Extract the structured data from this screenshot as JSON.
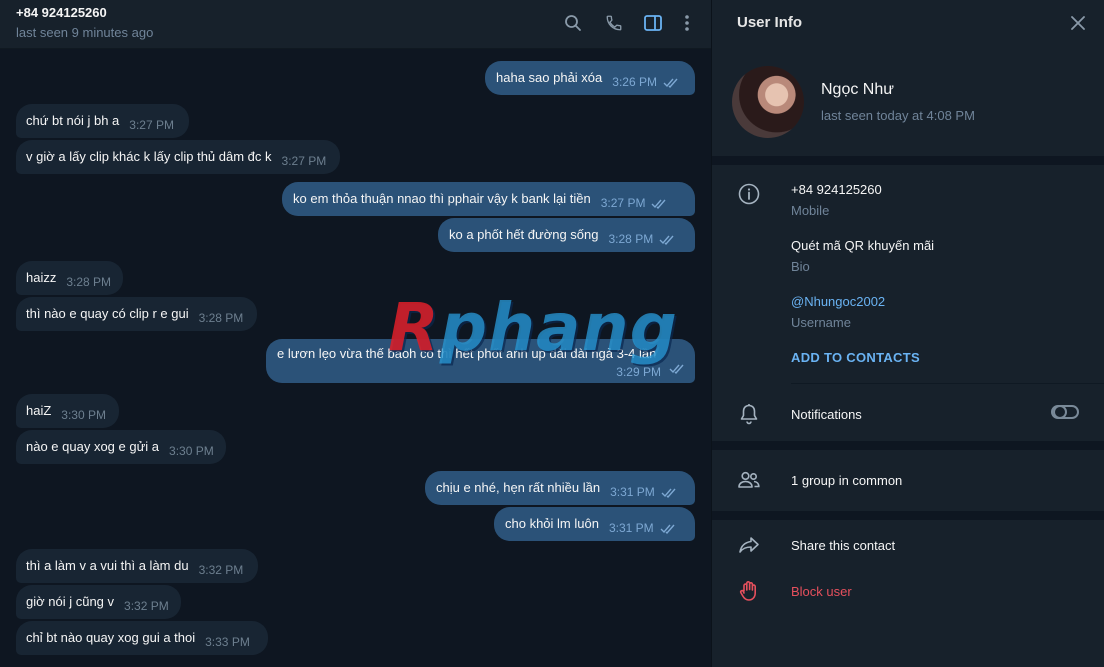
{
  "chat": {
    "title": "+84 924125260",
    "status": "last seen 9 minutes ago",
    "messages": [
      {
        "dir": "out",
        "text": "haha sao phải xóa",
        "time": "3:26 PM"
      },
      {
        "dir": "in",
        "text": "chứ bt nói j bh a",
        "time": "3:27 PM"
      },
      {
        "dir": "in",
        "text": "v giờ a lấy clip khác k lấy clip thủ dâm đc k",
        "time": "3:27 PM"
      },
      {
        "dir": "out",
        "text": "ko em thỏa thuận nnao thì pphair vậy k bank lại tiền",
        "time": "3:27 PM"
      },
      {
        "dir": "out",
        "text": "ko a phốt hết đường sống",
        "time": "3:28 PM"
      },
      {
        "dir": "in",
        "text": "haizz",
        "time": "3:28 PM"
      },
      {
        "dir": "in",
        "text": "thì nào e quay có clip r e gui",
        "time": "3:28 PM"
      },
      {
        "dir": "out",
        "text": "e lươn lẹo vừa thế baoh có thì hết phốt anh up dài dài ngả 3-4 lần",
        "time": "3:29 PM"
      },
      {
        "dir": "in",
        "text": "haiZ",
        "time": "3:30 PM"
      },
      {
        "dir": "in",
        "text": "nào e quay xog e gửi a",
        "time": "3:30 PM"
      },
      {
        "dir": "out",
        "text": "chịu e nhé, hẹn rất nhiều lần",
        "time": "3:31 PM"
      },
      {
        "dir": "out",
        "text": "cho khỏi lm luôn",
        "time": "3:31 PM"
      },
      {
        "dir": "in",
        "text": "thì a làm v a vui thì a làm du",
        "time": "3:32 PM"
      },
      {
        "dir": "in",
        "text": "giờ nói j cũng v",
        "time": "3:32 PM"
      },
      {
        "dir": "in",
        "text": "chỉ bt nào quay xog gui a thoi",
        "time": "3:33 PM"
      }
    ],
    "watermark": {
      "first": "R",
      "rest": "phang"
    }
  },
  "header_icons": [
    "search-icon",
    "phone-icon",
    "sidebar-toggle-icon",
    "more-vertical-icon"
  ],
  "info": {
    "title": "User Info",
    "name": "Ngọc Như",
    "last_seen": "last seen today at 4:08 PM",
    "phone": "+84 924125260",
    "phone_label": "Mobile",
    "bio": "Quét mã QR khuyến mãi",
    "bio_label": "Bio",
    "username": "@Nhungoc2002",
    "username_label": "Username",
    "add_to_contacts": "ADD TO CONTACTS",
    "notifications": "Notifications",
    "notifications_on": false,
    "groups_in_common": "1 group in common",
    "share_contact": "Share this contact",
    "block_user": "Block user"
  },
  "colors": {
    "accent": "#6ab3f3",
    "outgoing_bubble": "#2b5278",
    "incoming_bubble": "#182533",
    "danger": "#e6505d"
  }
}
